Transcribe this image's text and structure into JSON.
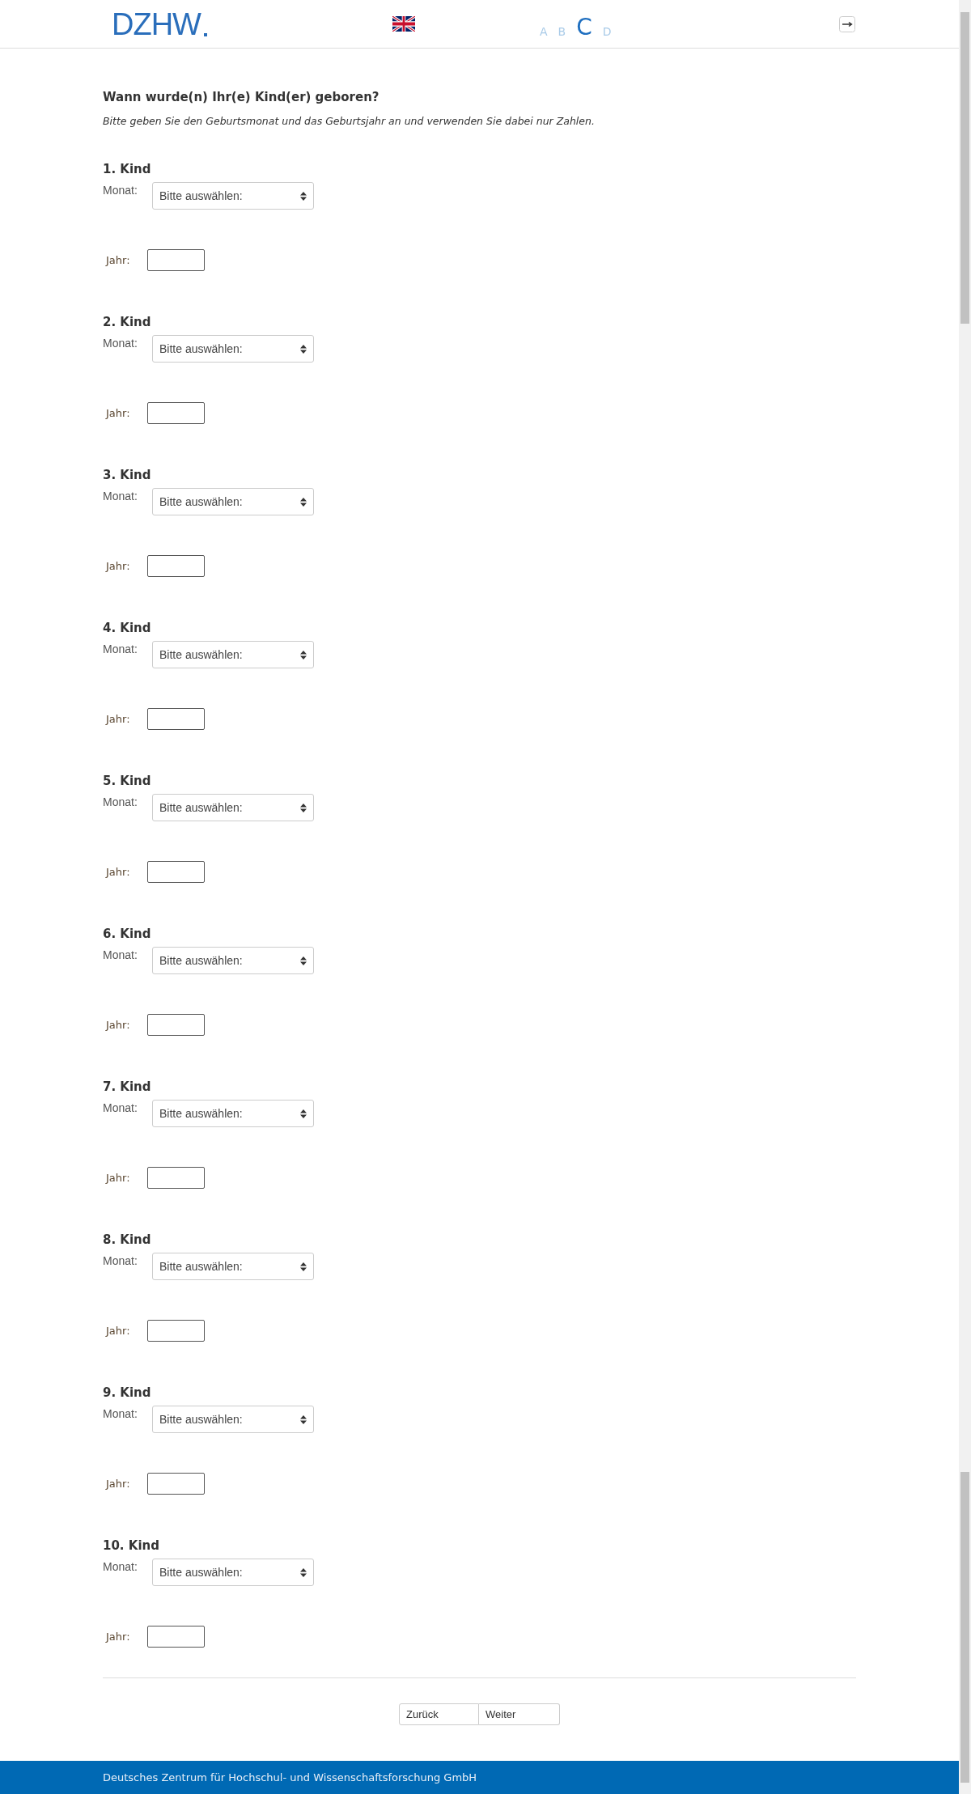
{
  "header": {
    "logo": "DZHW",
    "steps": [
      {
        "label": "A",
        "selected": false
      },
      {
        "label": "B",
        "selected": false
      },
      {
        "label": "C",
        "selected": true
      },
      {
        "label": "D",
        "selected": false
      }
    ]
  },
  "question": {
    "title": "Wann wurde(n) Ihr(e) Kind(er) geboren?",
    "instruction": "Bitte geben Sie den Geburtsmonat und das Geburtsjahr an und verwenden Sie dabei nur Zahlen."
  },
  "children": [
    {
      "heading": "1. Kind",
      "month_label": "Monat:",
      "month_select": "Bitte auswählen:",
      "year_label": "Jahr:"
    },
    {
      "heading": "2. Kind",
      "month_label": "Monat:",
      "month_select": "Bitte auswählen:",
      "year_label": "Jahr:"
    },
    {
      "heading": "3. Kind",
      "month_label": "Monat:",
      "month_select": "Bitte auswählen:",
      "year_label": "Jahr:"
    },
    {
      "heading": "4. Kind",
      "month_label": "Monat:",
      "month_select": "Bitte auswählen:",
      "year_label": "Jahr:"
    },
    {
      "heading": "5. Kind",
      "month_label": "Monat:",
      "month_select": "Bitte auswählen:",
      "year_label": "Jahr:"
    },
    {
      "heading": "6. Kind",
      "month_label": "Monat:",
      "month_select": "Bitte auswählen:",
      "year_label": "Jahr:"
    },
    {
      "heading": "7. Kind",
      "month_label": "Monat:",
      "month_select": "Bitte auswählen:",
      "year_label": "Jahr:"
    },
    {
      "heading": "8. Kind",
      "month_label": "Monat:",
      "month_select": "Bitte auswählen:",
      "year_label": "Jahr:"
    },
    {
      "heading": "9. Kind",
      "month_label": "Monat:",
      "month_select": "Bitte auswählen:",
      "year_label": "Jahr:"
    },
    {
      "heading": "10. Kind",
      "month_label": "Monat:",
      "month_select": "Bitte auswählen:",
      "year_label": "Jahr:"
    }
  ],
  "navigation": {
    "back": "Zurück",
    "next": "Weiter"
  },
  "footer": {
    "text": "Deutsches Zentrum für Hochschul- und Wissenschaftsforschung GmbH"
  }
}
